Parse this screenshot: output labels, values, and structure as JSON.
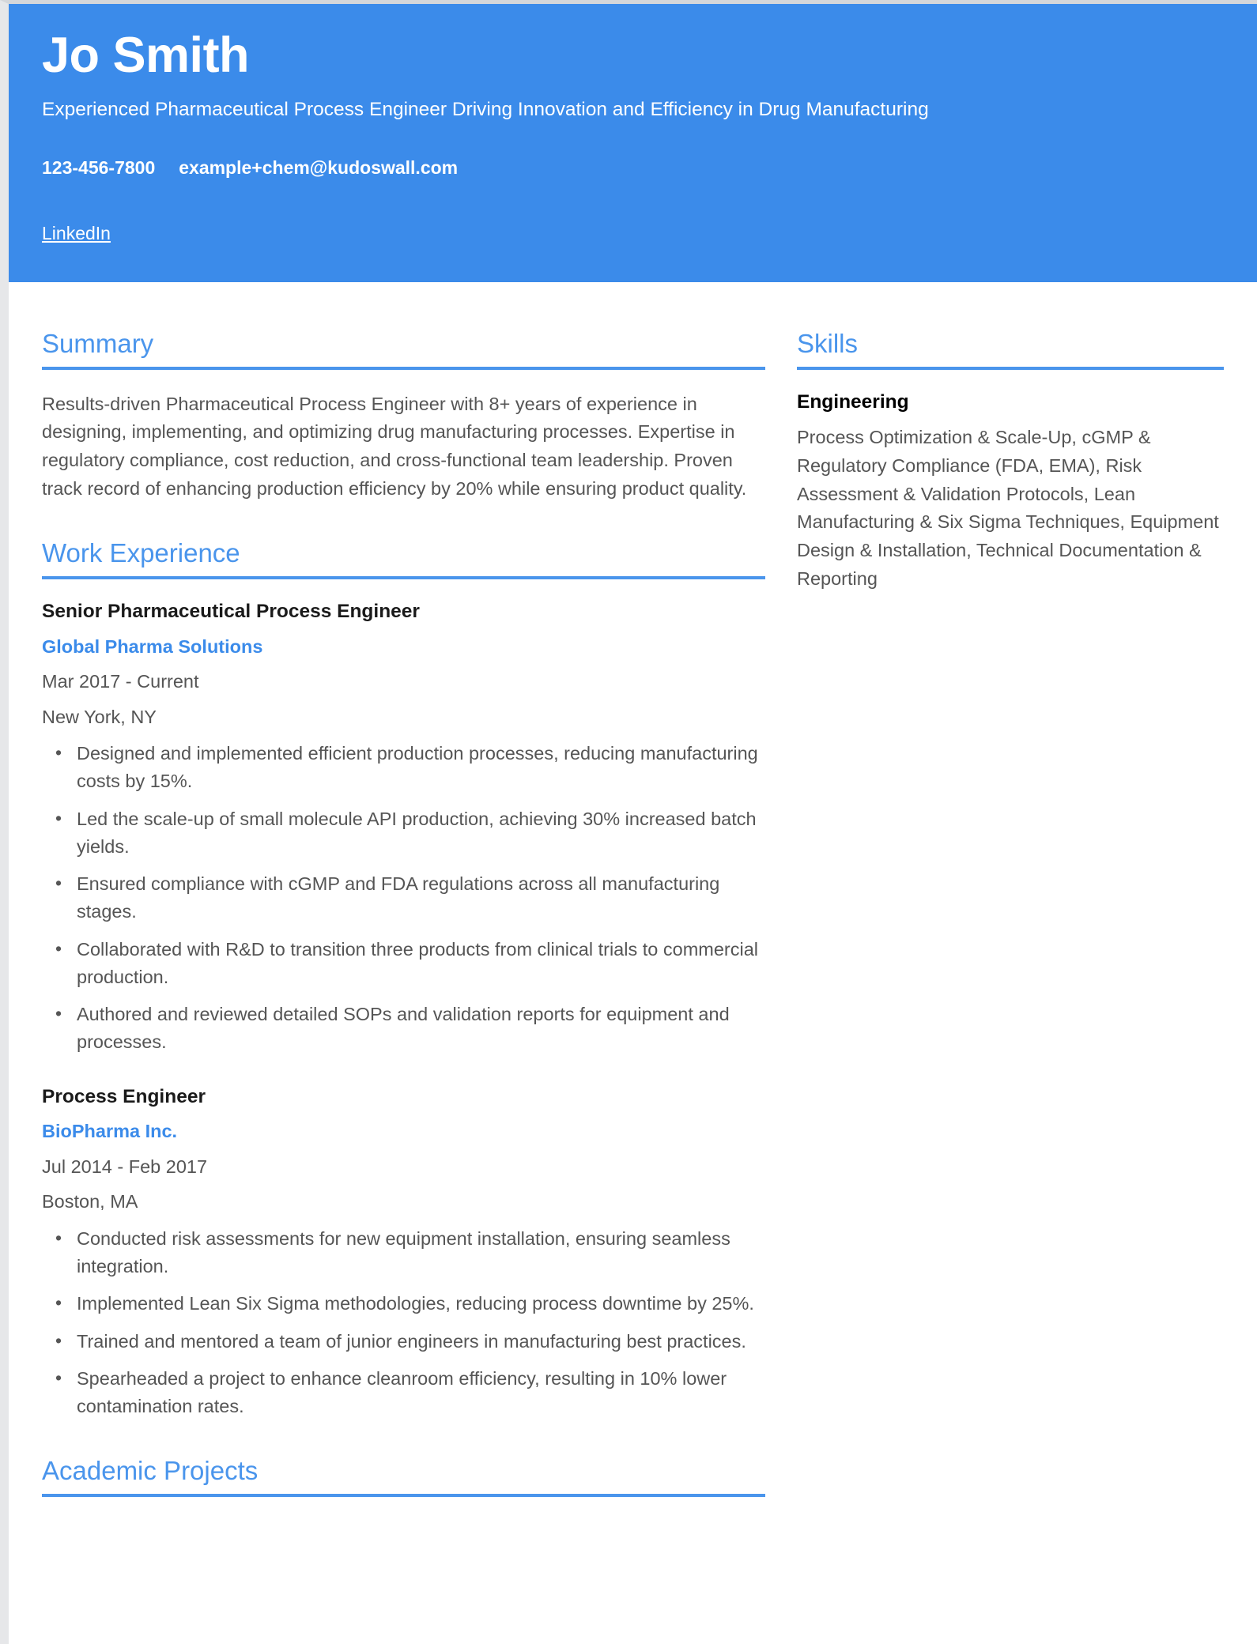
{
  "theme": {
    "banner_bg": "#3b8bea",
    "accent": "#4a95ec",
    "body_text": "#555555",
    "heading_text": "#1a1a1a"
  },
  "header": {
    "name": "Jo Smith",
    "tagline": "Experienced Pharmaceutical Process Engineer Driving Innovation and Efficiency in Drug Manufacturing",
    "phone": "123-456-7800",
    "email": "example+chem@kudoswall.com",
    "linkedin_label": "LinkedIn"
  },
  "summary": {
    "title": "Summary",
    "text": "Results-driven Pharmaceutical Process Engineer with 8+ years of experience in designing, implementing, and optimizing drug manufacturing processes. Expertise in regulatory compliance, cost reduction, and cross-functional team leadership. Proven track record of enhancing production efficiency by 20% while ensuring product quality."
  },
  "work_experience": {
    "title": "Work Experience",
    "jobs": [
      {
        "title": "Senior Pharmaceutical Process Engineer",
        "company": "Global Pharma Solutions",
        "dates": "Mar 2017 - Current",
        "location": "New York, NY",
        "bullets": [
          "Designed and implemented efficient production processes, reducing manufacturing costs by 15%.",
          "Led the scale-up of small molecule API production, achieving 30% increased batch yields.",
          "Ensured compliance with cGMP and FDA regulations across all manufacturing stages.",
          "Collaborated with R&D to transition three products from clinical trials to commercial production.",
          "Authored and reviewed detailed SOPs and validation reports for equipment and processes."
        ]
      },
      {
        "title": "Process Engineer",
        "company": "BioPharma Inc.",
        "dates": "Jul 2014 - Feb 2017",
        "location": "Boston, MA",
        "bullets": [
          "Conducted risk assessments for new equipment installation, ensuring seamless integration.",
          "Implemented Lean Six Sigma methodologies, reducing process downtime by 25%.",
          "Trained and mentored a team of junior engineers in manufacturing best practices.",
          "Spearheaded a project to enhance cleanroom efficiency, resulting in 10% lower contamination rates."
        ]
      }
    ]
  },
  "academic_projects": {
    "title": "Academic Projects"
  },
  "skills": {
    "title": "Skills",
    "groups": [
      {
        "name": "Engineering",
        "items": "Process Optimization & Scale-Up, cGMP & Regulatory Compliance (FDA, EMA), Risk Assessment & Validation Protocols, Lean Manufacturing & Six Sigma Techniques, Equipment Design & Installation, Technical Documentation & Reporting"
      }
    ]
  }
}
